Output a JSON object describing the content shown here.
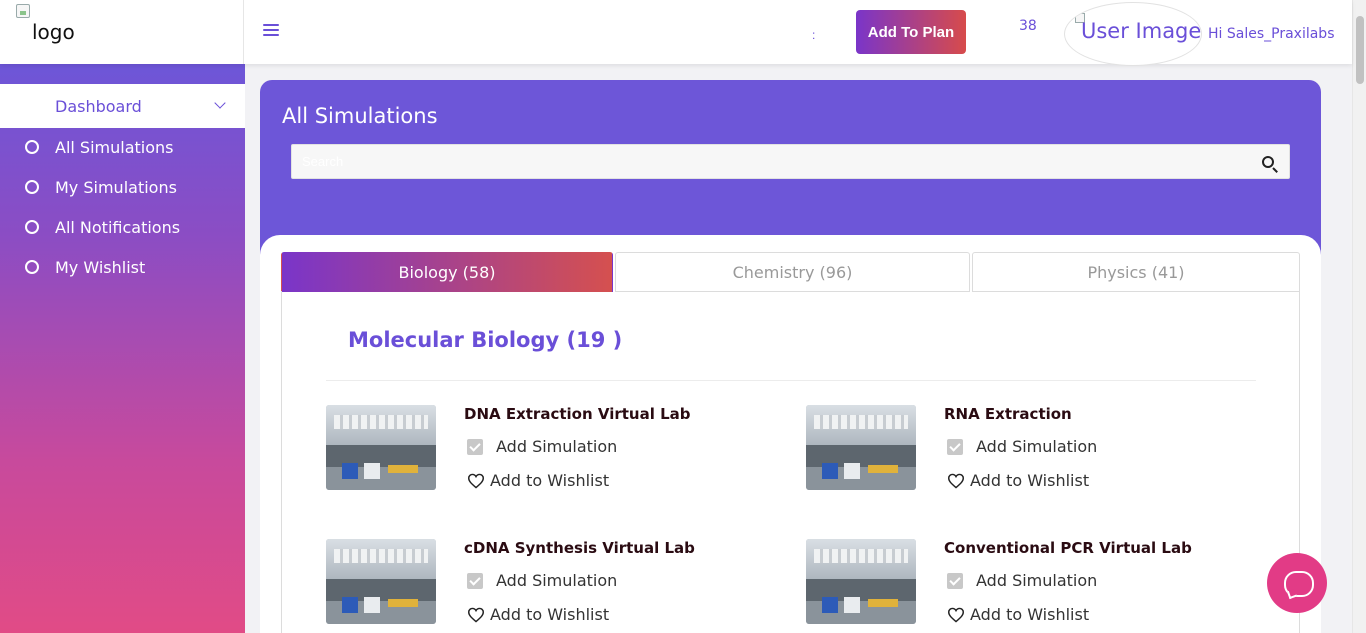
{
  "header": {
    "logo_alt": "logo",
    "separator": ":",
    "add_to_plan_label": "Add To Plan",
    "notification_count": "38",
    "user_image_alt": "User Image",
    "greeting": "Hi Sales_Praxilabs"
  },
  "sidebar": {
    "dashboard_label": "Dashboard",
    "items": [
      {
        "label": "All Simulations"
      },
      {
        "label": "My Simulations"
      },
      {
        "label": "All Notifications"
      },
      {
        "label": "My Wishlist"
      }
    ]
  },
  "banner": {
    "title": "All Simulations",
    "search_placeholder": "Search"
  },
  "tabs": [
    {
      "label": "Biology (58)",
      "active": true
    },
    {
      "label": "Chemistry (96)",
      "active": false
    },
    {
      "label": "Physics (41)",
      "active": false
    }
  ],
  "section": {
    "title": "Molecular Biology (19 )"
  },
  "simulations": [
    {
      "title": "DNA Extraction Virtual Lab",
      "add_label": "Add Simulation",
      "wishlist_label": "Add to Wishlist"
    },
    {
      "title": "RNA Extraction",
      "add_label": "Add Simulation",
      "wishlist_label": "Add to Wishlist"
    },
    {
      "title": "cDNA Synthesis Virtual Lab",
      "add_label": "Add Simulation",
      "wishlist_label": "Add to Wishlist"
    },
    {
      "title": "Conventional PCR Virtual Lab",
      "add_label": "Add Simulation",
      "wishlist_label": "Add to Wishlist"
    }
  ],
  "colors": {
    "primary": "#6d56d8",
    "gradient_start": "#7a35c9",
    "gradient_end": "#d74b4b",
    "chat": "#e23b86"
  }
}
